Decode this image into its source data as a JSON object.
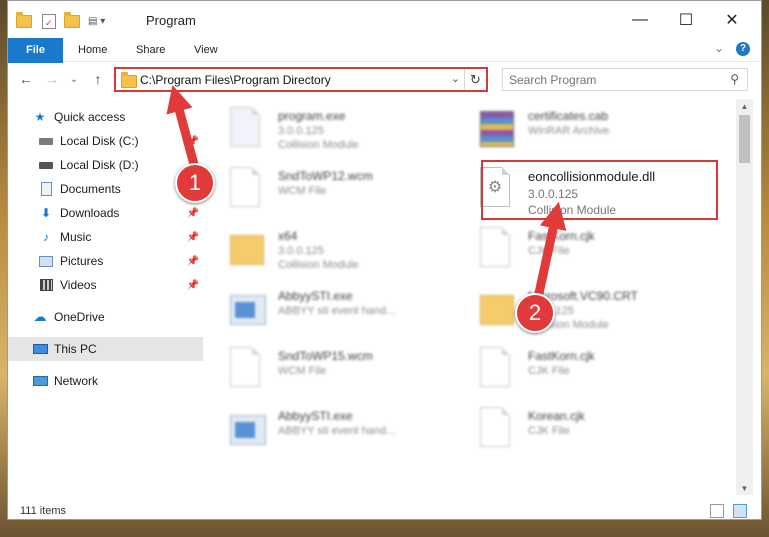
{
  "window": {
    "title": "Program",
    "controls": {
      "minimize": "—",
      "maximize": "☐",
      "close": "✕"
    }
  },
  "ribbon": {
    "tabs": [
      "File",
      "Home",
      "Share",
      "View"
    ],
    "expand": "⌄",
    "help": "?"
  },
  "nav": {
    "back": "←",
    "forward": "→",
    "recent": "⌄",
    "up": "↑",
    "address": "C:\\Program Files\\Program Directory",
    "refresh": "↻"
  },
  "search": {
    "placeholder": "Search Program",
    "icon": "magnifier-icon"
  },
  "sidebar": {
    "items": [
      {
        "label": "Quick access",
        "icon": "star-icon",
        "pinned": false
      },
      {
        "label": "Local Disk (C:)",
        "icon": "drive-icon",
        "pinned": true
      },
      {
        "label": "Local Disk (D:)",
        "icon": "drive-icon",
        "pinned": true
      },
      {
        "label": "Documents",
        "icon": "document-icon",
        "pinned": true
      },
      {
        "label": "Downloads",
        "icon": "download-icon",
        "pinned": true
      },
      {
        "label": "Music",
        "icon": "music-icon",
        "pinned": true
      },
      {
        "label": "Pictures",
        "icon": "pictures-icon",
        "pinned": true
      },
      {
        "label": "Videos",
        "icon": "video-icon",
        "pinned": true
      },
      {
        "label": "OneDrive",
        "icon": "cloud-icon",
        "pinned": false
      },
      {
        "label": "This PC",
        "icon": "computer-icon",
        "pinned": false,
        "selected": true
      },
      {
        "label": "Network",
        "icon": "network-icon",
        "pinned": false
      }
    ]
  },
  "files": [
    {
      "name": "program.exe",
      "line2": "3.0.0.125",
      "line3": "Collision Module",
      "icon": "gear-file-icon"
    },
    {
      "name": "certificates.cab",
      "line2": "WinRAR Archive",
      "line3": "",
      "icon": "archive-icon"
    },
    {
      "name": "SndToWP12.wcm",
      "line2": "WCM File",
      "line3": "",
      "icon": "file-icon"
    },
    {
      "name": "eoncollisionmodule.dll",
      "line2": "3.0.0.125",
      "line3": "Collision Module",
      "icon": "gear-file-icon"
    },
    {
      "name": "x64",
      "line2": "3.0.0.125",
      "line3": "Collision Module",
      "icon": "folder-icon"
    },
    {
      "name": "FastKorn.cjk",
      "line2": "CJK File",
      "line3": "",
      "icon": "file-icon"
    },
    {
      "name": "AbbyySTI.exe",
      "line2": "ABBYY sti event hand...",
      "line3": "",
      "icon": "app-icon"
    },
    {
      "name": "Microsoft.VC90.CRT",
      "line2": "3.0.0.125",
      "line3": "Collision Module",
      "icon": "folder-icon"
    },
    {
      "name": "SndToWP15.wcm",
      "line2": "WCM File",
      "line3": "",
      "icon": "file-icon"
    },
    {
      "name": "FastKorn.cjk",
      "line2": "CJK File",
      "line3": "",
      "icon": "file-icon"
    },
    {
      "name": "AbbyySTI.exe",
      "line2": "ABBYY sti event hand...",
      "line3": "",
      "icon": "app-icon"
    },
    {
      "name": "Korean.cjk",
      "line2": "CJK File",
      "line3": "",
      "icon": "file-icon"
    }
  ],
  "callouts": [
    "1",
    "2"
  ],
  "status": {
    "count": "111 items"
  },
  "colors": {
    "accent": "#1979ca",
    "highlight": "#d23a3a"
  }
}
